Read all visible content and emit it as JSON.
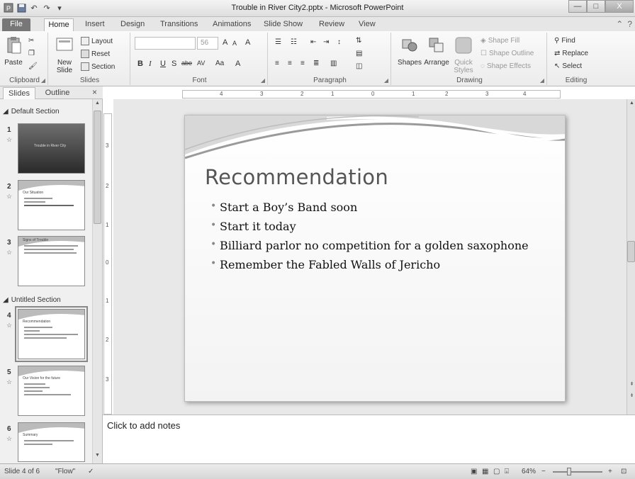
{
  "window": {
    "title": "Trouble in River City2.pptx - Microsoft PowerPoint",
    "min_glyph": "—",
    "max_glyph": "□",
    "close_glyph": "X"
  },
  "tabs": [
    "File",
    "Home",
    "Insert",
    "Design",
    "Transitions",
    "Animations",
    "Slide Show",
    "Review",
    "View"
  ],
  "ribbon": {
    "clipboard": {
      "label": "Clipboard",
      "paste": "Paste"
    },
    "slides": {
      "label": "Slides",
      "new_slide_1": "New",
      "new_slide_2": "Slide",
      "layout": "Layout",
      "reset": "Reset",
      "section": "Section"
    },
    "font": {
      "label": "Font",
      "font_name": "",
      "font_size": "56",
      "bold": "B",
      "italic": "I",
      "underline": "U",
      "strike": "abe",
      "shadow": "S",
      "spacing": "AV",
      "change_case": "Aa",
      "grow": "A",
      "shrink": "A",
      "clear": "A"
    },
    "paragraph": {
      "label": "Paragraph"
    },
    "drawing": {
      "label": "Drawing",
      "shapes": "Shapes",
      "arrange": "Arrange",
      "quick_styles_1": "Quick",
      "quick_styles_2": "Styles",
      "shape_fill": "Shape Fill",
      "shape_outline": "Shape Outline",
      "shape_effects": "Shape Effects"
    },
    "editing": {
      "label": "Editing",
      "find": "Find",
      "replace": "Replace",
      "select": "Select"
    }
  },
  "panel": {
    "tabs": [
      "Slides",
      "Outline"
    ],
    "close": "×",
    "sections": [
      "Default Section",
      "Untitled Section"
    ],
    "slides": [
      {
        "num": "1",
        "title": "Trouble in River City"
      },
      {
        "num": "2",
        "title": "Our Situation"
      },
      {
        "num": "3",
        "title": "Signs of Trouble"
      },
      {
        "num": "4",
        "title": "Recommendation"
      },
      {
        "num": "5",
        "title": "Our Vision for the future"
      },
      {
        "num": "6",
        "title": "Summary"
      }
    ]
  },
  "rulers": {
    "h": [
      "4",
      "3",
      "2",
      "1",
      "0",
      "1",
      "2",
      "3",
      "4"
    ],
    "v": [
      "3",
      "2",
      "1",
      "0",
      "1",
      "2",
      "3"
    ]
  },
  "slide": {
    "title": "Recommendation",
    "bullets": [
      "Start a Boy’s Band soon",
      "Start it today",
      "Billiard parlor no competition for a golden saxophone",
      "Remember the Fabled Walls of Jericho"
    ]
  },
  "notes": {
    "placeholder": "Click to add notes"
  },
  "status": {
    "slide_of": "Slide 4 of 6",
    "theme": "\"Flow\"",
    "zoom": "64%",
    "zoom_minus": "−",
    "zoom_plus": "+"
  }
}
